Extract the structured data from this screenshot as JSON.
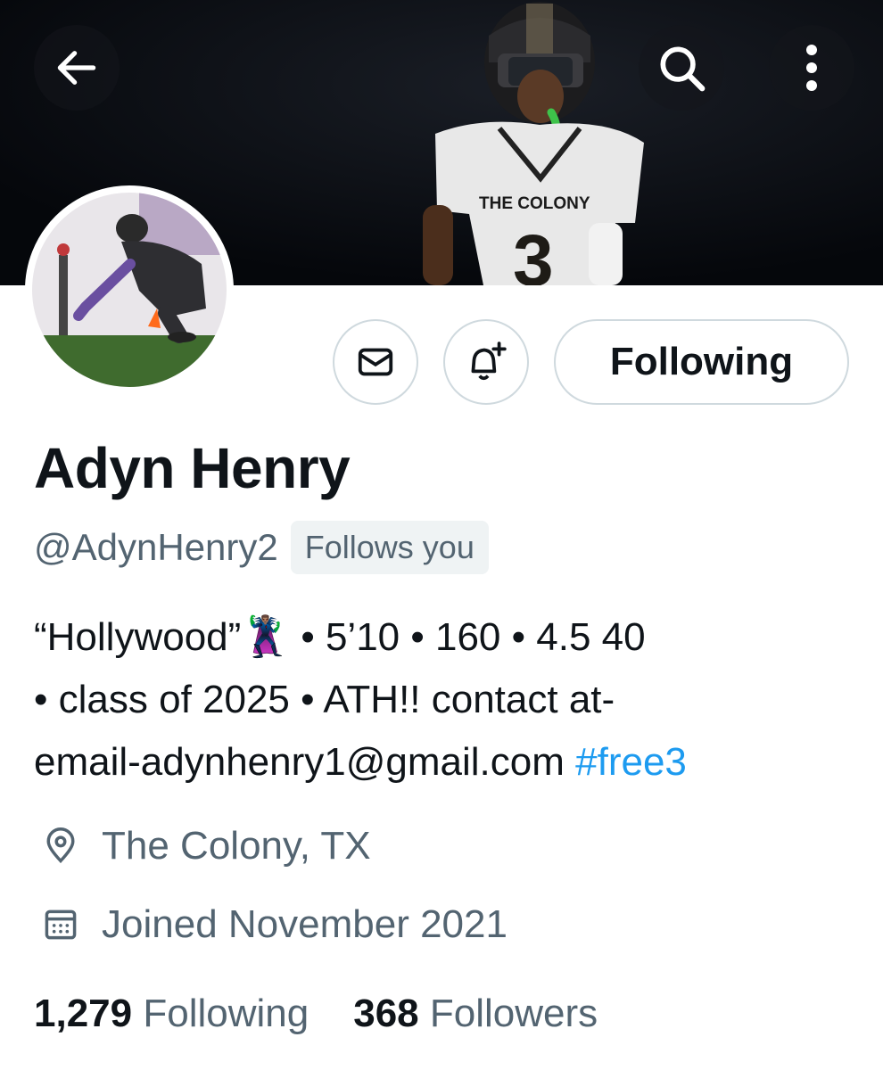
{
  "banner": {
    "jersey_text": "THE COLONY",
    "jersey_number": "3"
  },
  "actions": {
    "following_label": "Following"
  },
  "profile": {
    "name": "Adyn Henry",
    "handle": "@AdynHenry2",
    "follows_you": "Follows you",
    "bio_line1_a": "“Hollywood”",
    "bio_emoji": "🦹🏽‍♂️",
    "bio_line1_b": " • 5’10 • 160 • 4.5 40",
    "bio_line2": "• class of 2025 • ATH!! contact at-",
    "bio_line3": "email-adynhenry1@gmail.com ",
    "bio_hashtag": "#free3",
    "location": "The Colony, TX",
    "joined": "Joined November 2021"
  },
  "stats": {
    "following_count": "1,279",
    "following_label": "Following",
    "followers_count": "368",
    "followers_label": "Followers"
  },
  "colors": {
    "accent": "#1d9bf0",
    "muted_text": "#536471",
    "border": "#cfd9de"
  }
}
